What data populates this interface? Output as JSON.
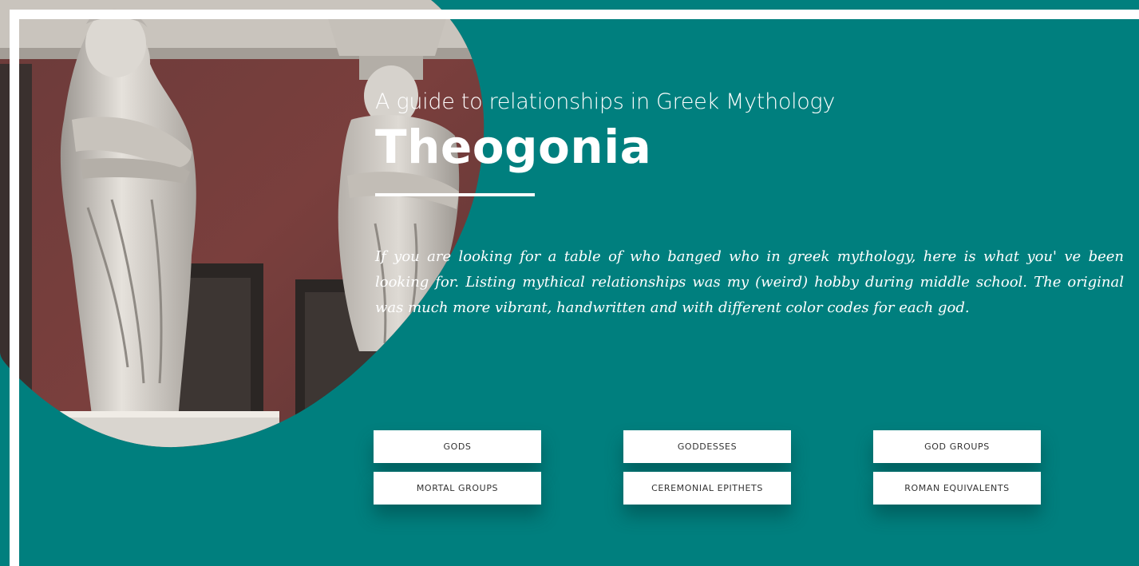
{
  "hero": {
    "subtitle": "A guide to relationships in Greek Mythology",
    "title": "Theogonia",
    "intro": "If you are looking for a table of who banged who in greek mythology, here is what you' ve been looking for. Listing mythical relationships was my (weird) hobby during middle school. The original was much more vibrant, handwritten and with different color codes for each god."
  },
  "nav": {
    "buttons": [
      {
        "label": "GODS"
      },
      {
        "label": "GODDESSES"
      },
      {
        "label": "GOD GROUPS"
      },
      {
        "label": "MORTAL GROUPS"
      },
      {
        "label": "CEREMONIAL EPITHETS"
      },
      {
        "label": "ROMAN EQUIVALENTS"
      }
    ]
  },
  "colors": {
    "background": "#007f7e",
    "frame": "#ffffff",
    "text": "#ffffff",
    "button_text": "#333333"
  }
}
